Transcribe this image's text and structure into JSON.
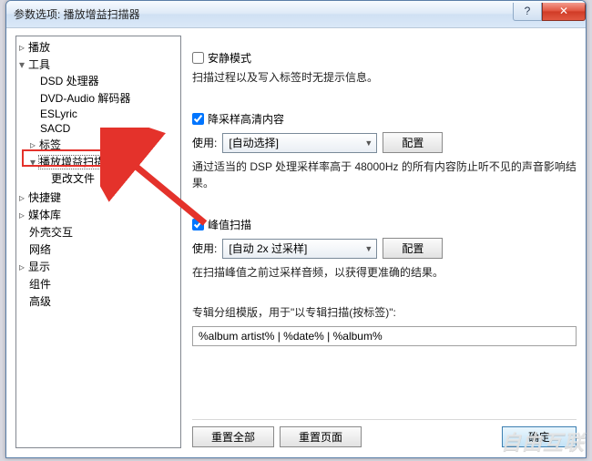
{
  "window": {
    "title": "参数选项: 播放增益扫描器"
  },
  "winControls": {
    "help": "?",
    "close": "✕"
  },
  "tree": {
    "playback": "播放",
    "tools": "工具",
    "dsd": "DSD 处理器",
    "dvd": "DVD-Audio 解码器",
    "eslyric": "ESLyric",
    "sacd": "SACD",
    "tags": "标签",
    "rgscan": "播放增益扫描器",
    "changefile": "更改文件",
    "shortcut": "快捷键",
    "medialib": "媒体库",
    "shell": "外壳交互",
    "network": "网络",
    "display": "显示",
    "components": "组件",
    "advanced": "高级"
  },
  "panel": {
    "quiet_label": "安静模式",
    "quiet_desc": "扫描过程以及写入标签时无提示信息。",
    "downsample_label": "降采样高清内容",
    "use": "使用:",
    "downsample_select": "[自动选择]",
    "configure": "配置",
    "downsample_desc": "通过适当的 DSP 处理采样率高于 48000Hz 的所有内容防止听不见的声音影响结果。",
    "peak_label": "峰值扫描",
    "peak_select": "[自动 2x 过采样]",
    "peak_desc": "在扫描峰值之前过采样音频，以获得更准确的结果。",
    "album_lbl": "专辑分组模版，用于\"以专辑扫描(按标签)\":",
    "album_value": "%album artist% | %date% | %album%"
  },
  "footer": {
    "reset_all": "重置全部",
    "reset_page": "重置页面",
    "ok": "确定"
  },
  "watermark": "自由互联"
}
